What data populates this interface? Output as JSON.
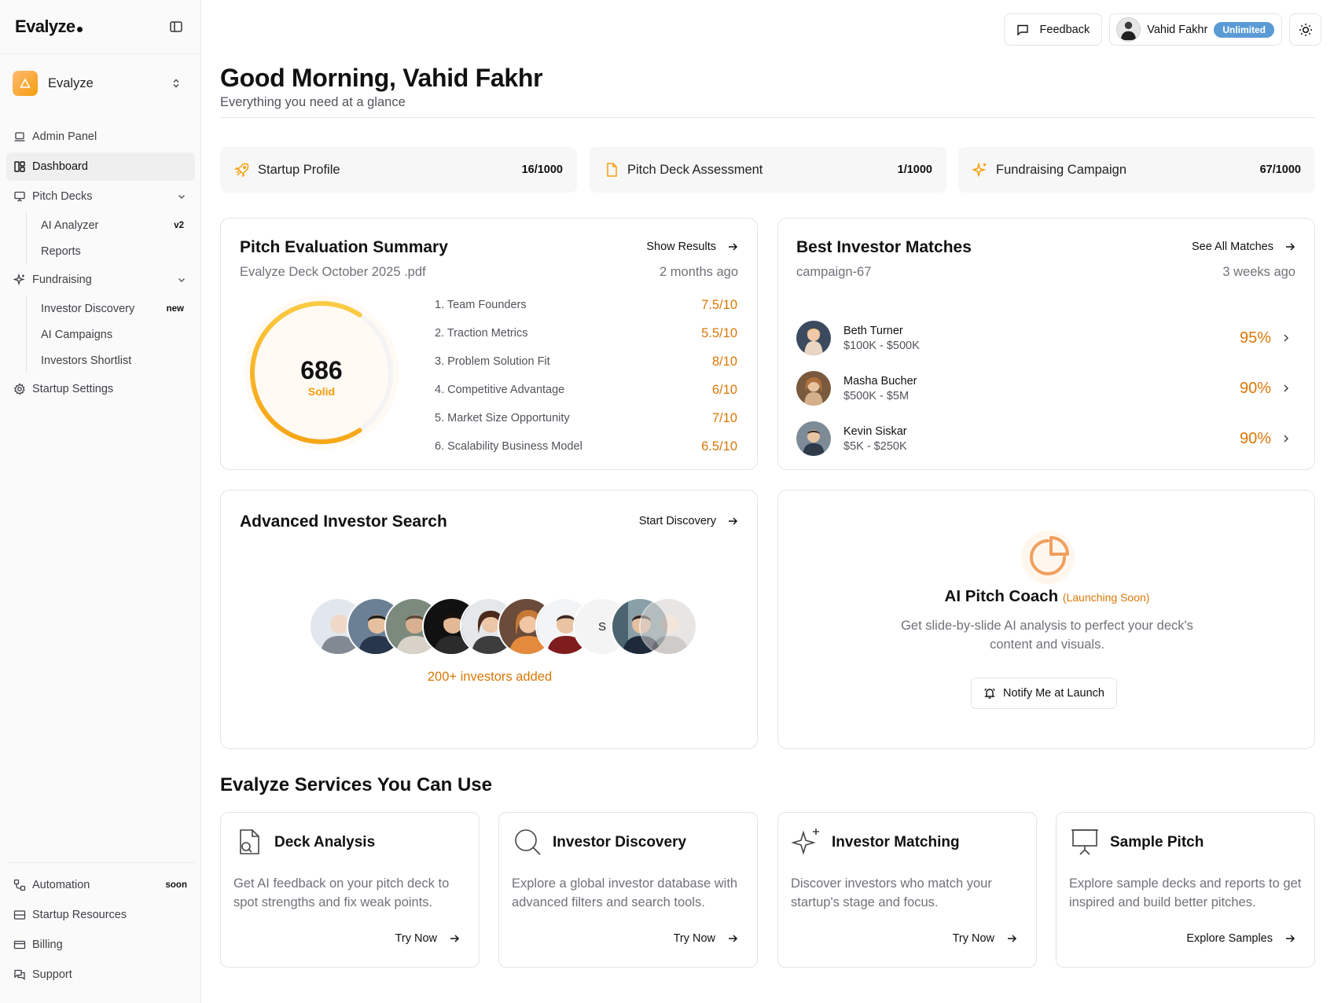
{
  "brand": {
    "logo": "Evalyze"
  },
  "workspace": {
    "name": "Evalyze"
  },
  "sidebar": {
    "items": [
      {
        "label": "Admin Panel"
      },
      {
        "label": "Dashboard"
      },
      {
        "label": "Pitch Decks"
      },
      {
        "label": "AI Analyzer",
        "tag": "v2"
      },
      {
        "label": "Reports"
      },
      {
        "label": "Fundraising"
      },
      {
        "label": "Investor Discovery",
        "tag": "new"
      },
      {
        "label": "AI Campaigns"
      },
      {
        "label": "Investors Shortlist"
      },
      {
        "label": "Startup Settings"
      }
    ],
    "bottom": [
      {
        "label": "Automation",
        "tag": "soon"
      },
      {
        "label": "Startup Resources"
      },
      {
        "label": "Billing"
      },
      {
        "label": "Support"
      }
    ]
  },
  "topbar": {
    "feedback": "Feedback",
    "user_name": "Vahid Fakhr",
    "plan": "Unlimited"
  },
  "header": {
    "greeting": "Good Morning, Vahid Fakhr",
    "subtitle": "Everything you need at a glance"
  },
  "stats": [
    {
      "label": "Startup Profile",
      "value": "16/1000"
    },
    {
      "label": "Pitch Deck Assessment",
      "value": "1/1000"
    },
    {
      "label": "Fundraising Campaign",
      "value": "67/1000"
    }
  ],
  "pitch_summary": {
    "title": "Pitch Evaluation Summary",
    "link": "Show Results",
    "file": "Evalyze Deck October 2025 .pdf",
    "time": "2 months ago",
    "score": "686",
    "score_label": "Solid",
    "score_fraction": 0.686,
    "criteria": [
      {
        "name": "1. Team Founders",
        "score": "7.5/10"
      },
      {
        "name": "2. Traction Metrics",
        "score": "5.5/10"
      },
      {
        "name": "3. Problem Solution Fit",
        "score": "8/10"
      },
      {
        "name": "4. Competitive Advantage",
        "score": "6/10"
      },
      {
        "name": "5. Market Size Opportunity",
        "score": "7/10"
      },
      {
        "name": "6. Scalability Business Model",
        "score": "6.5/10"
      }
    ]
  },
  "investor_matches": {
    "title": "Best Investor Matches",
    "link": "See All Matches",
    "campaign": "campaign-67",
    "time": "3 weeks ago",
    "items": [
      {
        "name": "Beth Turner",
        "range": "$100K - $500K",
        "pct": "95%"
      },
      {
        "name": "Masha Bucher",
        "range": "$500K - $5M",
        "pct": "90%"
      },
      {
        "name": "Kevin Siskar",
        "range": "$5K - $250K",
        "pct": "90%"
      }
    ]
  },
  "advanced_search": {
    "title": "Advanced Investor Search",
    "link": "Start Discovery",
    "initial": "S",
    "added": "200+ investors added"
  },
  "coach": {
    "title": "AI Pitch Coach",
    "soon": "(Launching Soon)",
    "desc": "Get slide-by-slide AI analysis to perfect your deck's content and visuals.",
    "button": "Notify Me at Launch"
  },
  "services": {
    "title": "Evalyze Services You Can Use",
    "items": [
      {
        "title": "Deck Analysis",
        "desc": "Get AI feedback on your pitch deck to spot strengths and fix weak points.",
        "link": "Try Now"
      },
      {
        "title": "Investor Discovery",
        "desc": "Explore a global investor database with advanced filters and search tools.",
        "link": "Try Now"
      },
      {
        "title": "Investor Matching",
        "desc": "Discover investors who match your startup's stage and focus.",
        "link": "Try Now"
      },
      {
        "title": "Sample Pitch",
        "desc": "Explore sample decks and reports to get inspired and build better pitches.",
        "link": "Explore Samples"
      }
    ]
  },
  "colors": {
    "accent": "#f59e0b",
    "score": "#d97706",
    "badge": "#5b9bd5"
  }
}
